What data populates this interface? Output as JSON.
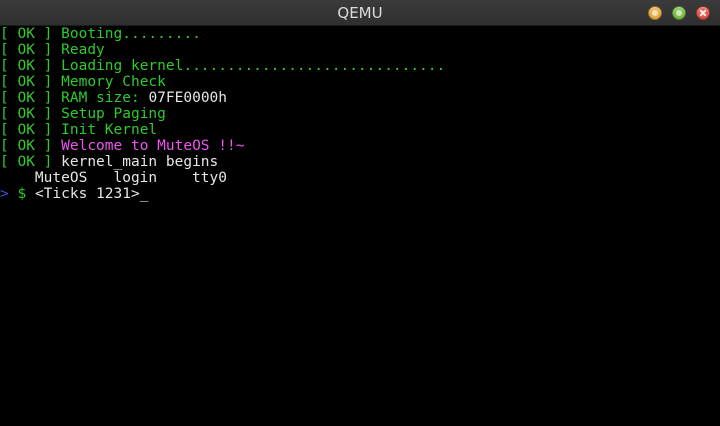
{
  "window": {
    "title": "QEMU"
  },
  "boot_lines": [
    {
      "status": "[ OK ]",
      "message": "Booting.........",
      "tail": ""
    },
    {
      "status": "[ OK ]",
      "message": "Ready",
      "tail": ""
    },
    {
      "status": "[ OK ]",
      "message": "Loading kernel..............................",
      "tail": ""
    },
    {
      "status": "[ OK ]",
      "message": "Memory Check",
      "tail": ""
    },
    {
      "status": "[ OK ]",
      "message": "RAM size: ",
      "tail": "07FE0000h"
    },
    {
      "status": "[ OK ]",
      "message": "Setup Paging",
      "tail": ""
    },
    {
      "status": "[ OK ]",
      "message": "Init Kernel",
      "tail": ""
    },
    {
      "status": "[ OK ]",
      "message": "Welcome to MuteOS !!~",
      "tail": ""
    },
    {
      "status": "[ OK ]",
      "message": "kernel_main begins",
      "tail": ""
    }
  ],
  "login_line": "    MuteOS   login    tty0",
  "prompt": {
    "arrow": ">",
    "dollar": "$",
    "text": "<Ticks 1231>",
    "cursor": "_"
  },
  "colors": {
    "ok_green": "#2ecb2e",
    "welcome_magenta": "#ee55ee",
    "prompt_arrow_blue": "#3e4fd6",
    "text_white": "#e6e6e6"
  }
}
